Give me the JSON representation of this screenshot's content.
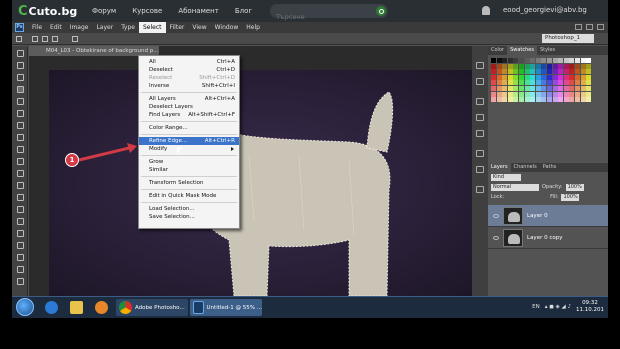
{
  "site": {
    "logo": "Cuto.bg",
    "nav": [
      "Форум",
      "Курсове",
      "Абонамент",
      "Блог"
    ],
    "search_placeholder": "Търсене",
    "user": "eood_georgievi@abv.bg"
  },
  "photoshop": {
    "logo": "Ps",
    "menus": [
      "File",
      "Edit",
      "Image",
      "Layer",
      "Type",
      "Select",
      "Filter",
      "View",
      "Window",
      "Help"
    ],
    "active_menu": "Select",
    "workspace": "Photoshop_1",
    "doc_tab": "M04_L03 - Obtekirane of background p...",
    "panel_tabs_top": [
      "Color",
      "Swatches",
      "Styles"
    ],
    "panel_tabs_bottom": [
      "Layers",
      "Channels",
      "Paths"
    ],
    "layer_filter": "Kind",
    "blend_mode": "Normal",
    "opacity_label": "Opacity:",
    "opacity_value": "100%",
    "lock_label": "Lock:",
    "fill_label": "Fill:",
    "fill_value": "100%",
    "layers": [
      {
        "name": "Layer 0",
        "selected": true
      },
      {
        "name": "Layer 0 copy",
        "selected": false
      }
    ]
  },
  "select_menu": [
    {
      "label": "All",
      "key": "Ctrl+A",
      "state": "normal"
    },
    {
      "label": "Deselect",
      "key": "Ctrl+D",
      "state": "normal"
    },
    {
      "label": "Reselect",
      "key": "Shift+Ctrl+D",
      "state": "disabled"
    },
    {
      "label": "Inverse",
      "key": "Shift+Ctrl+I",
      "state": "normal"
    },
    {
      "label": "All Layers",
      "key": "Alt+Ctrl+A",
      "state": "normal"
    },
    {
      "label": "Deselect Layers",
      "key": "",
      "state": "normal"
    },
    {
      "label": "Find Layers",
      "key": "Alt+Shift+Ctrl+F",
      "state": "normal"
    },
    {
      "label": "Color Range...",
      "key": "",
      "state": "normal"
    },
    {
      "label": "Refine Edge...",
      "key": "Alt+Ctrl+R",
      "state": "highlighted"
    },
    {
      "label": "Modify",
      "key": "",
      "state": "submenu"
    },
    {
      "label": "Grow",
      "key": "",
      "state": "normal"
    },
    {
      "label": "Similar",
      "key": "",
      "state": "normal"
    },
    {
      "label": "Transform Selection",
      "key": "",
      "state": "normal"
    },
    {
      "label": "Edit in Quick Mask Mode",
      "key": "",
      "state": "normal"
    },
    {
      "label": "Load Selection...",
      "key": "",
      "state": "normal"
    },
    {
      "label": "Save Selection...",
      "key": "",
      "state": "normal"
    }
  ],
  "annotation": {
    "number": "1",
    "color": "#d23b45"
  },
  "taskbar": {
    "chrome_label": "Adobe Photosho...",
    "ps_label": "Untitled-1 @ 55% ...",
    "lang": "EN",
    "time": "09:32",
    "date": "11.10.201"
  },
  "colors": {
    "accent": "#3b74c9",
    "site_bg": "#2a2f33",
    "canvas_bg": "#2a1f38"
  }
}
